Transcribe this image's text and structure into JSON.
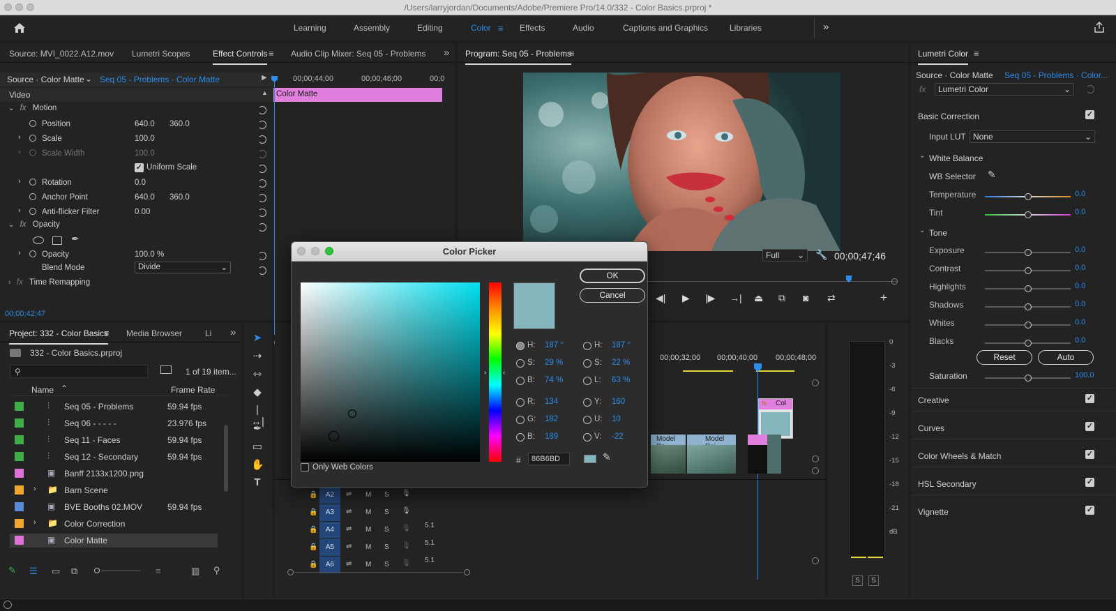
{
  "window": {
    "title": "/Users/larryjordan/Documents/Adobe/Premiere Pro/14.0/332 - Color Basics.prproj *"
  },
  "workspaces": [
    "Learning",
    "Assembly",
    "Editing",
    "Color",
    "Effects",
    "Audio",
    "Captions and Graphics",
    "Libraries"
  ],
  "source_panel": {
    "tabs": [
      "Source: MVI_0022.A12.mov",
      "Lumetri Scopes",
      "Effect Controls",
      "Audio Clip Mixer: Seq 05 - Problems"
    ],
    "source_label": "Source · Color Matte",
    "seq_label": "Seq 05 - Problems · Color Matte",
    "ruler": [
      "00;00;44;00",
      "00;00;46;00",
      "00;0"
    ],
    "clip_label": "Color Matte",
    "video_header": "Video",
    "rows": [
      {
        "label": "Motion",
        "v1": "",
        "v2": ""
      },
      {
        "label": "Position",
        "v1": "640.0",
        "v2": "360.0"
      },
      {
        "label": "Scale",
        "v1": "100.0",
        "v2": ""
      },
      {
        "label": "Scale Width",
        "v1": "100.0",
        "v2": ""
      },
      {
        "label": "Uniform Scale",
        "v1": "",
        "v2": ""
      },
      {
        "label": "Rotation",
        "v1": "0.0",
        "v2": ""
      },
      {
        "label": "Anchor Point",
        "v1": "640.0",
        "v2": "360.0"
      },
      {
        "label": "Anti-flicker Filter",
        "v1": "0.00",
        "v2": ""
      },
      {
        "label": "Opacity",
        "v1": "",
        "v2": ""
      },
      {
        "label": "Opacity",
        "v1": "100.0 %",
        "v2": ""
      },
      {
        "label": "Blend Mode",
        "v1": "Divide",
        "v2": ""
      },
      {
        "label": "Time Remapping",
        "v1": "",
        "v2": ""
      }
    ],
    "fx": "fx",
    "timecode": "00;00;42;47"
  },
  "program": {
    "title": "Program: Seq 05 - Problems",
    "zoom": "Full",
    "timecode": "00;00;47;46"
  },
  "lumetri": {
    "title": "Lumetri Color",
    "source_label": "Source · Color Matte",
    "seq_label": "Seq 05 - Problems · Color...",
    "effect": "Lumetri Color",
    "basic": "Basic Correction",
    "input_lut_label": "Input LUT",
    "input_lut": "None",
    "white_balance": "White Balance",
    "wb_selector": "WB Selector",
    "temperature": {
      "label": "Temperature",
      "value": "0.0"
    },
    "tint": {
      "label": "Tint",
      "value": "0.0"
    },
    "tone": "Tone",
    "tone_rows": [
      {
        "label": "Exposure",
        "value": "0.0"
      },
      {
        "label": "Contrast",
        "value": "0.0"
      },
      {
        "label": "Highlights",
        "value": "0.0"
      },
      {
        "label": "Shadows",
        "value": "0.0"
      },
      {
        "label": "Whites",
        "value": "0.0"
      },
      {
        "label": "Blacks",
        "value": "0.0"
      }
    ],
    "reset": "Reset",
    "auto": "Auto",
    "saturation": {
      "label": "Saturation",
      "value": "100.0"
    },
    "sections": [
      "Creative",
      "Curves",
      "Color Wheels & Match",
      "HSL Secondary",
      "Vignette"
    ]
  },
  "project": {
    "tabs": [
      "Project: 332 - Color Basics",
      "Media Browser",
      "Li"
    ],
    "file": "332 - Color Basics.prproj",
    "count": "1 of 19 item...",
    "col_name": "Name",
    "col_rate": "Frame Rate",
    "items": [
      {
        "name": "Seq 05 - Problems",
        "rate": "59.94 fps",
        "color": "#3fae4a"
      },
      {
        "name": "Seq 06 - - - - -",
        "rate": "23.976 fps",
        "color": "#3fae4a"
      },
      {
        "name": "Seq 11 - Faces",
        "rate": "59.94 fps",
        "color": "#3fae4a"
      },
      {
        "name": "Seq 12 - Secondary",
        "rate": "59.94 fps",
        "color": "#3fae4a"
      },
      {
        "name": "Banff 2133x1200.png",
        "rate": "",
        "color": "#e071d8"
      },
      {
        "name": "Barn Scene",
        "rate": "",
        "color": "#f0a530"
      },
      {
        "name": "BVE Booths 02.MOV",
        "rate": "59.94 fps",
        "color": "#5b8ad6"
      },
      {
        "name": "Color Correction",
        "rate": "",
        "color": "#f0a530"
      },
      {
        "name": "Color Matte",
        "rate": "",
        "color": "#e071d8"
      }
    ]
  },
  "timeline": {
    "ruler": [
      "00;00;32;00",
      "00;00;40;00",
      "00;00;48;00"
    ],
    "tracks": [
      {
        "name": "A2",
        "extra": ""
      },
      {
        "name": "A3",
        "extra": ""
      },
      {
        "name": "A4",
        "extra": "5.1"
      },
      {
        "name": "A5",
        "extra": "5.1"
      },
      {
        "name": "A6",
        "extra": "5.1"
      }
    ],
    "m": "M",
    "s": "S",
    "clips": [
      {
        "label": "Model Ra"
      },
      {
        "label": "Model Rai"
      },
      {
        "label": "Col"
      }
    ]
  },
  "meter": {
    "scale": [
      "0",
      "-3",
      "-6",
      "-9",
      "-12",
      "-15",
      "-18",
      "-21",
      "dB"
    ],
    "solo": "S"
  },
  "color_picker": {
    "title": "Color Picker",
    "ok": "OK",
    "cancel": "Cancel",
    "swatch": "#86B6BD",
    "left": [
      {
        "l": "H:",
        "v": "187 °"
      },
      {
        "l": "S:",
        "v": "29 %"
      },
      {
        "l": "B:",
        "v": "74 %"
      },
      {
        "l": "R:",
        "v": "134"
      },
      {
        "l": "G:",
        "v": "182"
      },
      {
        "l": "B:",
        "v": "189"
      }
    ],
    "right": [
      {
        "l": "H:",
        "v": "187 °"
      },
      {
        "l": "S:",
        "v": "22 %"
      },
      {
        "l": "L:",
        "v": "63 %"
      },
      {
        "l": "Y:",
        "v": "160"
      },
      {
        "l": "U:",
        "v": "10"
      },
      {
        "l": "V:",
        "v": "-22"
      }
    ],
    "hash": "#",
    "hex": "86B6BD",
    "web_only": "Only Web Colors"
  }
}
